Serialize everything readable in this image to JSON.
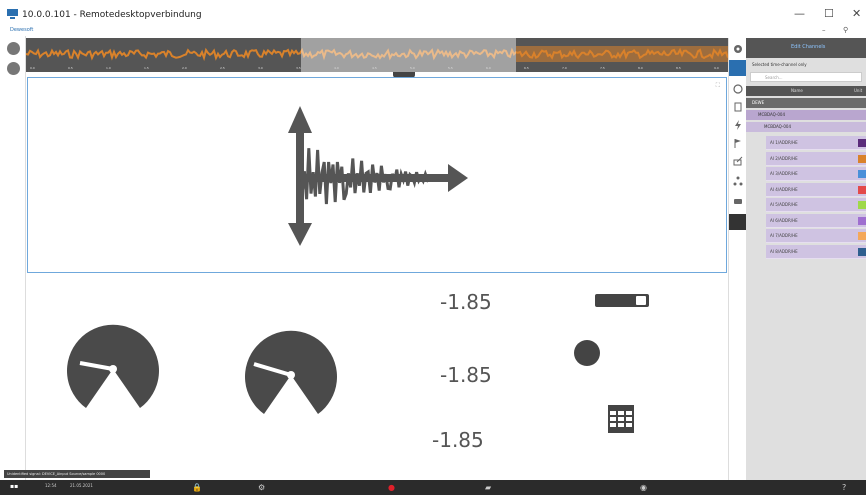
{
  "window": {
    "title": "10.0.0.101 - Remotedesktopverbindung",
    "sub_label": "Dewesoft",
    "minimize": "—",
    "maximize": "☐",
    "close": "✕",
    "inner_min": "–",
    "inner_pin": "⚲"
  },
  "panel": {
    "header": "Edit Channels",
    "option": "Selected time-channel only",
    "search_placeholder": "Search...",
    "tabs": [
      "Name",
      "Unit"
    ],
    "tree": [
      {
        "label": "DEWE",
        "level": 0
      },
      {
        "label": "MCBDAQ-004",
        "level": 1
      },
      {
        "label": "MCBDAQ-004",
        "level": 2
      }
    ],
    "channels": [
      {
        "label": "AI 1/ADDR/HE",
        "color": "#5a2c7a"
      },
      {
        "label": "AI 2/ADDR/HE",
        "color": "#d9822b"
      },
      {
        "label": "AI 3/ADDR/HE",
        "color": "#4a90d9"
      },
      {
        "label": "AI 4/ADDR/HE",
        "color": "#e34a4a"
      },
      {
        "label": "AI 5/ADDR/HE",
        "color": "#9fd94a"
      },
      {
        "label": "AI 6/ADDR/HE",
        "color": "#9f6fd0"
      },
      {
        "label": "AI 7/ADDR/HE",
        "color": "#f4a85a"
      },
      {
        "label": "AI 8/ADDR/HE",
        "color": "#2f5f8f"
      }
    ]
  },
  "overview": {
    "ticks": [
      "0.0",
      "0.5",
      "1.0",
      "1.5",
      "2.0",
      "2.5",
      "3.0",
      "3.5",
      "4.0",
      "4.5",
      "5.0",
      "5.5",
      "6.0",
      "6.5",
      "7.0",
      "7.5",
      "8.0",
      "8.5",
      "9.0"
    ],
    "wave_color": "#d9822b"
  },
  "readouts": [
    "-1.85",
    "-1.85",
    "-1.85"
  ],
  "gauges": [
    {
      "value_fraction": 0.22
    },
    {
      "value_fraction": 0.2
    }
  ],
  "toggle": {
    "state": "on"
  },
  "status_message": "Unidentified signal: DEVICE_Ainput Source/sample 0000",
  "taskbar": {
    "time": "12:54",
    "date": "21.05.2021"
  },
  "colors": {
    "accent": "#2a6fb0",
    "widget": "#4a4a4a",
    "panel_bg": "#dfdfdf",
    "channel_row": "#cfc3e2"
  }
}
